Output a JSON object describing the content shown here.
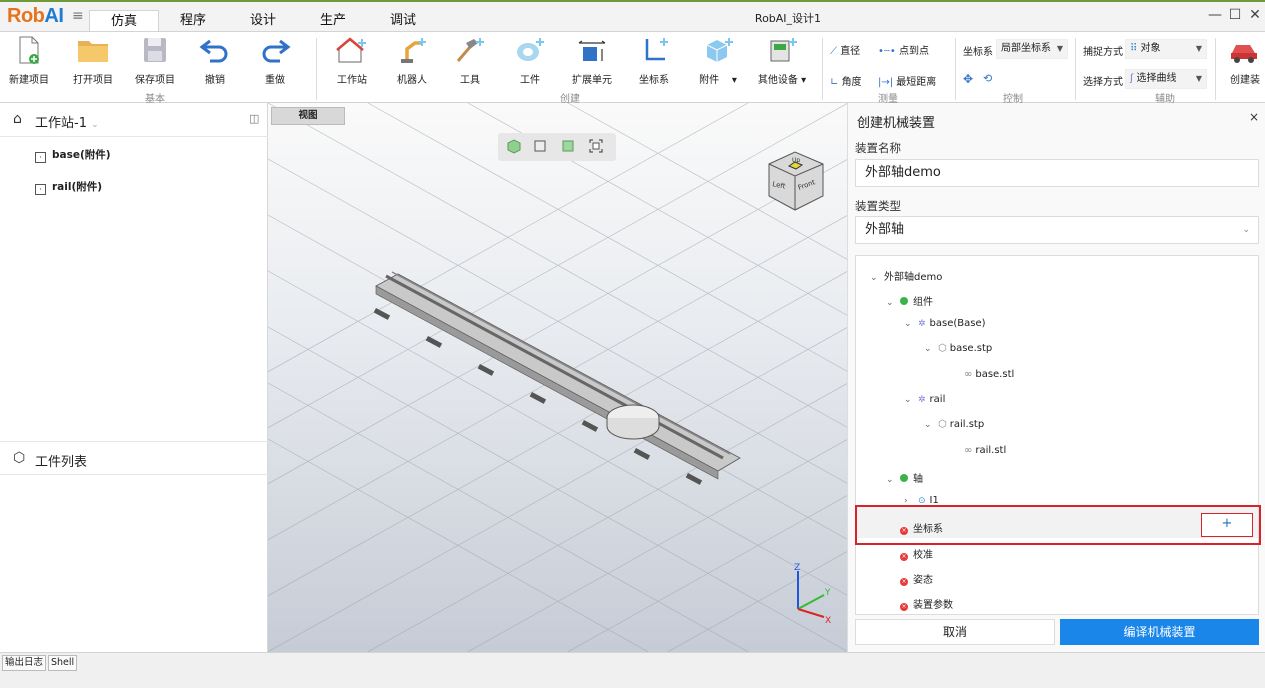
{
  "app": {
    "logo": "RobAI",
    "window_title": "RobAI_设计1"
  },
  "menu_tabs": [
    "仿真",
    "程序",
    "设计",
    "生产",
    "调试"
  ],
  "ribbon": {
    "basic": {
      "group": "基本",
      "new": "新建项目",
      "open": "打开项目",
      "save": "保存项目",
      "undo": "撤销",
      "redo": "重做"
    },
    "create": {
      "group": "创建",
      "station": "工作站",
      "robot": "机器人",
      "tool": "工具",
      "workpiece": "工件",
      "ext": "扩展单元",
      "frame": "坐标系",
      "attach": "附件",
      "other": "其他设备"
    },
    "measure": {
      "group": "测量",
      "diameter": "直径",
      "p2p": "点到点",
      "angle": "角度",
      "shortest": "最短距离"
    },
    "control": {
      "group": "控制",
      "frame_label": "坐标系",
      "frame_value": "局部坐标系"
    },
    "aux": {
      "group": "辅助",
      "capture_label": "捕捉方式",
      "capture_value": "对象",
      "select_label": "选择方式",
      "select_value": "选择曲线",
      "create": "创建装"
    }
  },
  "left": {
    "station": "工作站-1",
    "items": [
      "base(附件)",
      "rail(附件)"
    ],
    "workpiece_list": "工件列表"
  },
  "viewport": {
    "tab": "视图",
    "cube_up": "Up",
    "cube_left": "Left",
    "cube_front": "Front",
    "axis_x": "X",
    "axis_y": "Y",
    "axis_z": "Z"
  },
  "panel": {
    "title": "创建机械装置",
    "name_label": "装置名称",
    "name_value": "外部轴demo",
    "type_label": "装置类型",
    "type_value": "外部轴",
    "tree": {
      "root": "外部轴demo",
      "components": "组件",
      "base": "base(Base)",
      "base_stp": "base.stp",
      "base_stl": "base.stl",
      "rail": "rail",
      "rail_stp": "rail.stp",
      "rail_stl": "rail.stl",
      "axis": "轴",
      "j1": "J1",
      "frame": "坐标系",
      "calib": "校准",
      "pose": "姿态",
      "params": "装置参数"
    },
    "add": "+",
    "cancel": "取消",
    "compile": "编译机械装置"
  },
  "status_tabs": [
    "输出日志",
    "Shell"
  ]
}
